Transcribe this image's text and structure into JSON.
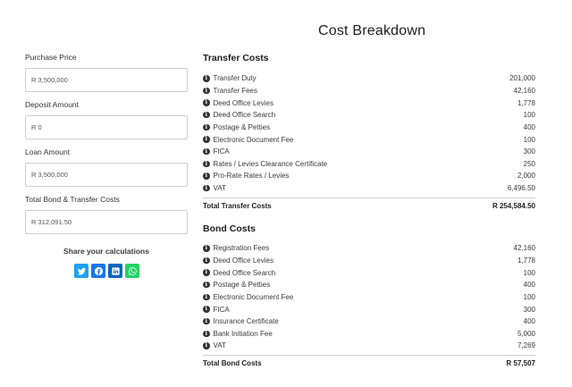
{
  "header": {
    "title": "Cost Breakdown"
  },
  "form": {
    "fields": [
      {
        "label": "Purchase Price",
        "value": "R 3,500,000"
      },
      {
        "label": "Deposit Amount",
        "value": "R 0"
      },
      {
        "label": "Loan Amount",
        "value": "R 3,500,000"
      },
      {
        "label": "Total Bond & Transfer Costs",
        "value": "R 312,091.50"
      }
    ]
  },
  "share": {
    "title": "Share your calculations",
    "buttons": [
      {
        "name": "twitter",
        "icon": "twitter-icon",
        "color": "#1da1f2"
      },
      {
        "name": "facebook",
        "icon": "facebook-icon",
        "color": "#1877f2"
      },
      {
        "name": "linkedin",
        "icon": "linkedin-icon",
        "color": "#0a66c2"
      },
      {
        "name": "whatsapp",
        "icon": "whatsapp-icon",
        "color": "#25d366"
      }
    ]
  },
  "transfer": {
    "title": "Transfer Costs",
    "items": [
      {
        "label": "Transfer Duty",
        "value": "201,000"
      },
      {
        "label": "Transfer Fees",
        "value": "42,160"
      },
      {
        "label": "Deed Office Levies",
        "value": "1,778"
      },
      {
        "label": "Deed Office Search",
        "value": "100"
      },
      {
        "label": "Postage & Petties",
        "value": "400"
      },
      {
        "label": "Electronic Document Fee",
        "value": "100"
      },
      {
        "label": "FICA",
        "value": "300"
      },
      {
        "label": "Rates / Levies Clearance Certificate",
        "value": "250"
      },
      {
        "label": "Pro-Rate Rates / Levies",
        "value": "2,000"
      },
      {
        "label": "VAT",
        "value": "6,496.50"
      }
    ],
    "total_label": "Total Transfer Costs",
    "total_value": "R 254,584.50"
  },
  "bond": {
    "title": "Bond Costs",
    "items": [
      {
        "label": "Registration Fees",
        "value": "42,160"
      },
      {
        "label": "Deed Office Levies",
        "value": "1,778"
      },
      {
        "label": "Deed Office Search",
        "value": "100"
      },
      {
        "label": "Postage & Petties",
        "value": "400"
      },
      {
        "label": "Electronic Document Fee",
        "value": "100"
      },
      {
        "label": "FICA",
        "value": "300"
      },
      {
        "label": "Insurance Certificate",
        "value": "400"
      },
      {
        "label": "Bank Initiation Fee",
        "value": "5,000"
      },
      {
        "label": "VAT",
        "value": "7,269"
      }
    ],
    "total_label": "Total Bond Costs",
    "total_value": "R 57,507"
  }
}
